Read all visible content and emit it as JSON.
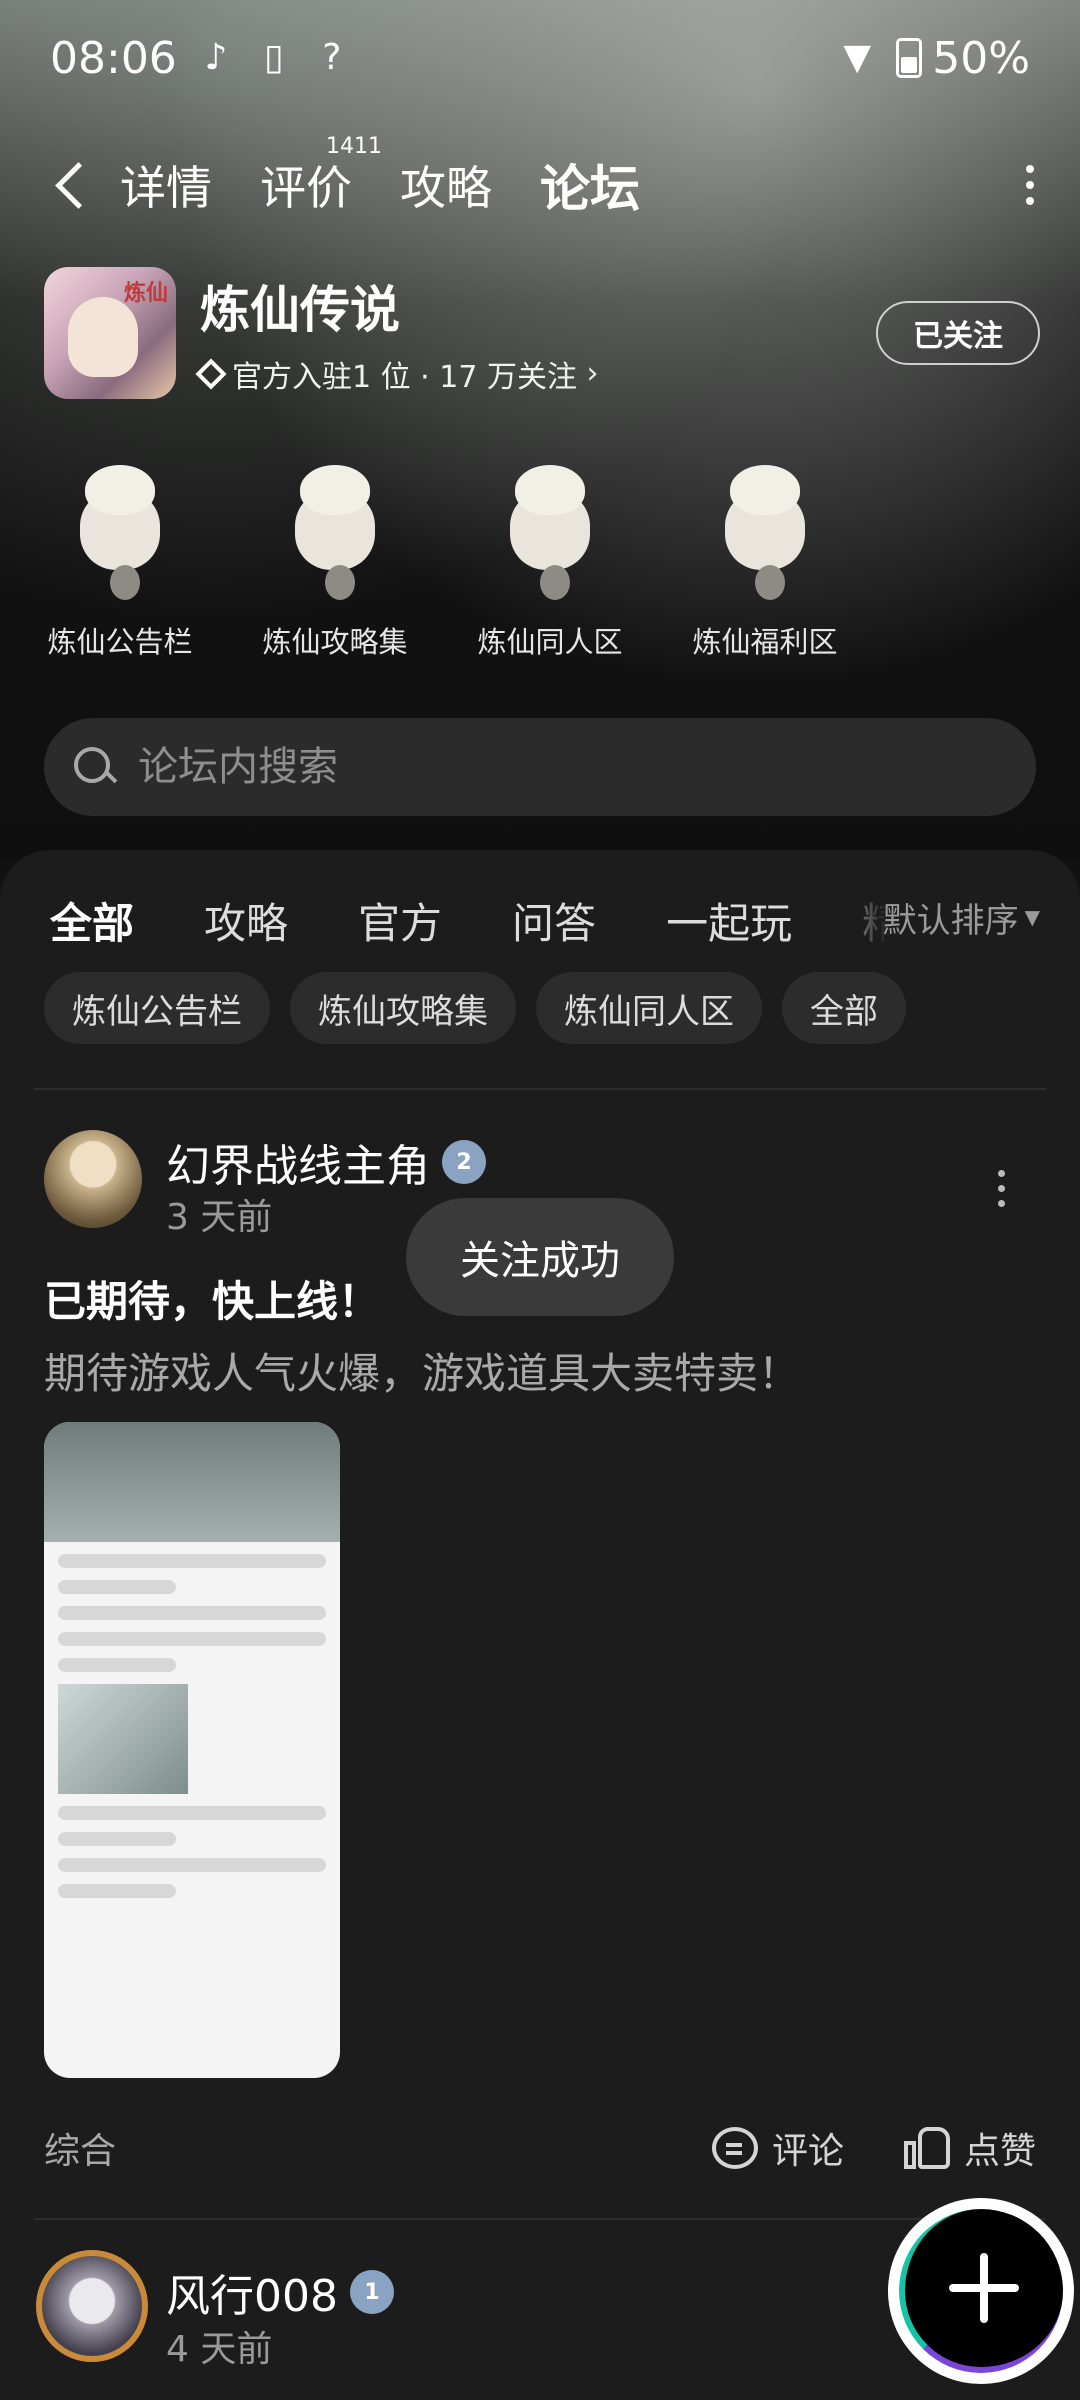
{
  "status_bar": {
    "time": "08:06",
    "battery": "50%",
    "icons": [
      "tiktok-icon",
      "phone-sync-icon",
      "unknown-app-icon",
      "wifi-icon",
      "battery-icon"
    ]
  },
  "topnav": {
    "tabs": [
      {
        "label": "详情"
      },
      {
        "label": "评价",
        "badge": "1411"
      },
      {
        "label": "攻略"
      },
      {
        "label": "论坛",
        "active": true
      }
    ]
  },
  "app": {
    "title": "炼仙传说",
    "meta": "官方入驻1 位 · 17 万关注",
    "follow_label": "已关注"
  },
  "subforums": [
    "炼仙公告栏",
    "炼仙攻略集",
    "炼仙同人区",
    "炼仙福利区"
  ],
  "search": {
    "placeholder": "论坛内搜索"
  },
  "category_tabs": [
    "全部",
    "攻略",
    "官方",
    "问答",
    "一起玩",
    "精华"
  ],
  "sort": {
    "label": "默认排序"
  },
  "chips": [
    "炼仙公告栏",
    "炼仙攻略集",
    "炼仙同人区",
    "全部"
  ],
  "post1": {
    "user": "幻界战线主角",
    "level": "2",
    "time": "3 天前",
    "title": "已期待，快上线！",
    "body": "期待游戏人气火爆，游戏道具大卖特卖！",
    "tag": "综合",
    "comment_label": "评论",
    "like_label": "点赞"
  },
  "post2": {
    "user": "风行008",
    "level": "1",
    "time": "4 天前"
  },
  "toast": "关注成功",
  "colors": {
    "accent": "#16c3a6",
    "panel": "#1c1c1c"
  }
}
